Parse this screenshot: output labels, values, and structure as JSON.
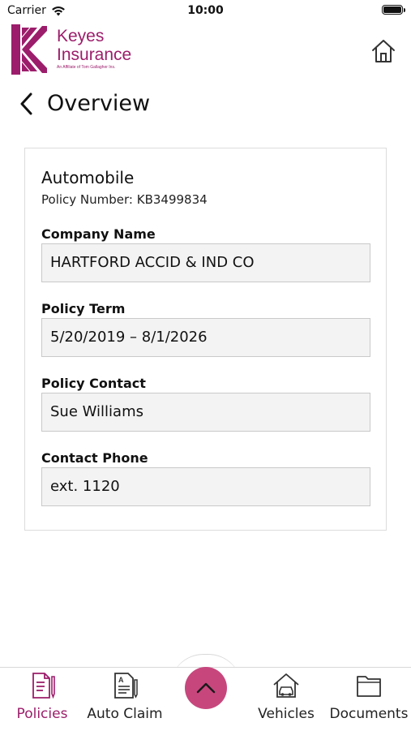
{
  "status_bar": {
    "carrier": "Carrier",
    "time": "10:00"
  },
  "brand": {
    "name_line1": "Keyes",
    "name_line2": "Insurance",
    "tagline": "An Affiliate of Tom Gallagher Ins.",
    "color": "#9c1d6b"
  },
  "header": {
    "title": "Overview"
  },
  "policy": {
    "type": "Automobile",
    "number_text": "Policy Number: KB3499834",
    "fields": [
      {
        "label": "Company Name",
        "value": "HARTFORD ACCID & IND CO"
      },
      {
        "label": "Policy Term",
        "value": "5/20/2019 – 8/1/2026"
      },
      {
        "label": "Policy Contact",
        "value": "Sue Williams"
      },
      {
        "label": "Contact Phone",
        "value": "ext. 1120"
      }
    ]
  },
  "tabs": [
    {
      "label": "Policies",
      "icon": "policies-icon",
      "active": true
    },
    {
      "label": "Auto Claim",
      "icon": "auto-claim-icon",
      "active": false
    },
    {
      "label": "Vehicles",
      "icon": "vehicles-icon",
      "active": false
    },
    {
      "label": "Documents",
      "icon": "documents-icon",
      "active": false
    }
  ],
  "colors": {
    "accent": "#9c1d6b",
    "fab": "#c7477d",
    "field_bg": "#f3f3f3"
  }
}
